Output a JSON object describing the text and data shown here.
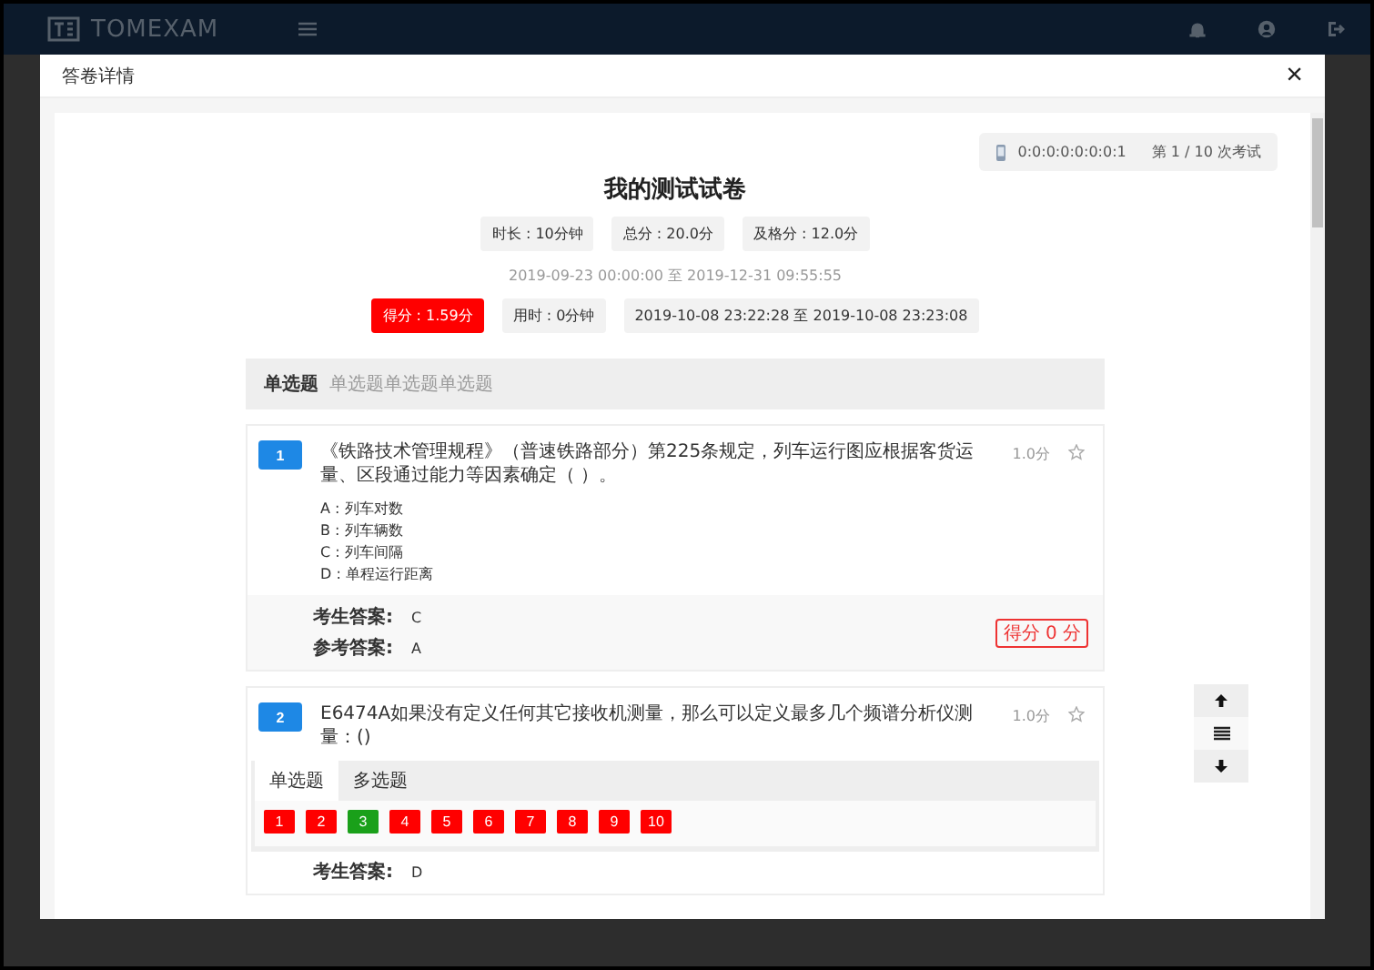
{
  "app": {
    "brand": "TOMEXAM"
  },
  "dialog": {
    "title": "答卷详情",
    "close": "×"
  },
  "attempt": {
    "ip": "0:0:0:0:0:0:0:1",
    "attempt": "第 1 / 10 次考试"
  },
  "paper": {
    "title": "我的测试试卷",
    "meta": [
      "时长 : 10分钟",
      "总分 : 20.0分",
      "及格分 : 12.0分"
    ],
    "period": "2019-09-23 00:00:00 至 2019-12-31 09:55:55",
    "result": [
      {
        "text": "得分 : 1.59分",
        "kind": "score"
      },
      {
        "text": "用时 : 0分钟",
        "kind": "plain"
      },
      {
        "text": "2019-10-08 23:22:28 至 2019-10-08 23:23:08",
        "kind": "plain"
      }
    ]
  },
  "section": {
    "title": "单选题",
    "description": "单选题单选题单选题"
  },
  "questions": [
    {
      "number": "1",
      "text": "《铁路技术管理规程》（普速铁路部分）第225条规定，列车运行图应根据客货运量、区段通过能力等因素确定（ ）。",
      "points": "1.0分",
      "starred": false,
      "options": [
        "A : 列车对数",
        "B : 列车辆数",
        "C : 列车间隔",
        "D : 单程运行距离"
      ],
      "answers": [
        {
          "label": "考生答案:",
          "value": "C"
        },
        {
          "label": "参考答案:",
          "value": "A"
        }
      ],
      "score": "得分 0 分"
    },
    {
      "number": "2",
      "text": "E6474A如果没有定义任何其它接收机测量，那么可以定义最多几个频谱分析仪测量：()",
      "points": "1.0分",
      "starred": false,
      "answers": [
        {
          "label": "考生答案:",
          "value": "D"
        }
      ]
    }
  ],
  "answer_sheet": {
    "tabs": [
      {
        "label": "单选题",
        "selected": true
      },
      {
        "label": "多选题",
        "selected": false
      }
    ],
    "items": [
      {
        "label": "1",
        "correct": false
      },
      {
        "label": "2",
        "correct": false
      },
      {
        "label": "3",
        "correct": true
      },
      {
        "label": "4",
        "correct": false
      },
      {
        "label": "5",
        "correct": false
      },
      {
        "label": "6",
        "correct": false
      },
      {
        "label": "7",
        "correct": false
      },
      {
        "label": "8",
        "correct": false
      },
      {
        "label": "9",
        "correct": false
      },
      {
        "label": "10",
        "correct": false
      }
    ]
  }
}
